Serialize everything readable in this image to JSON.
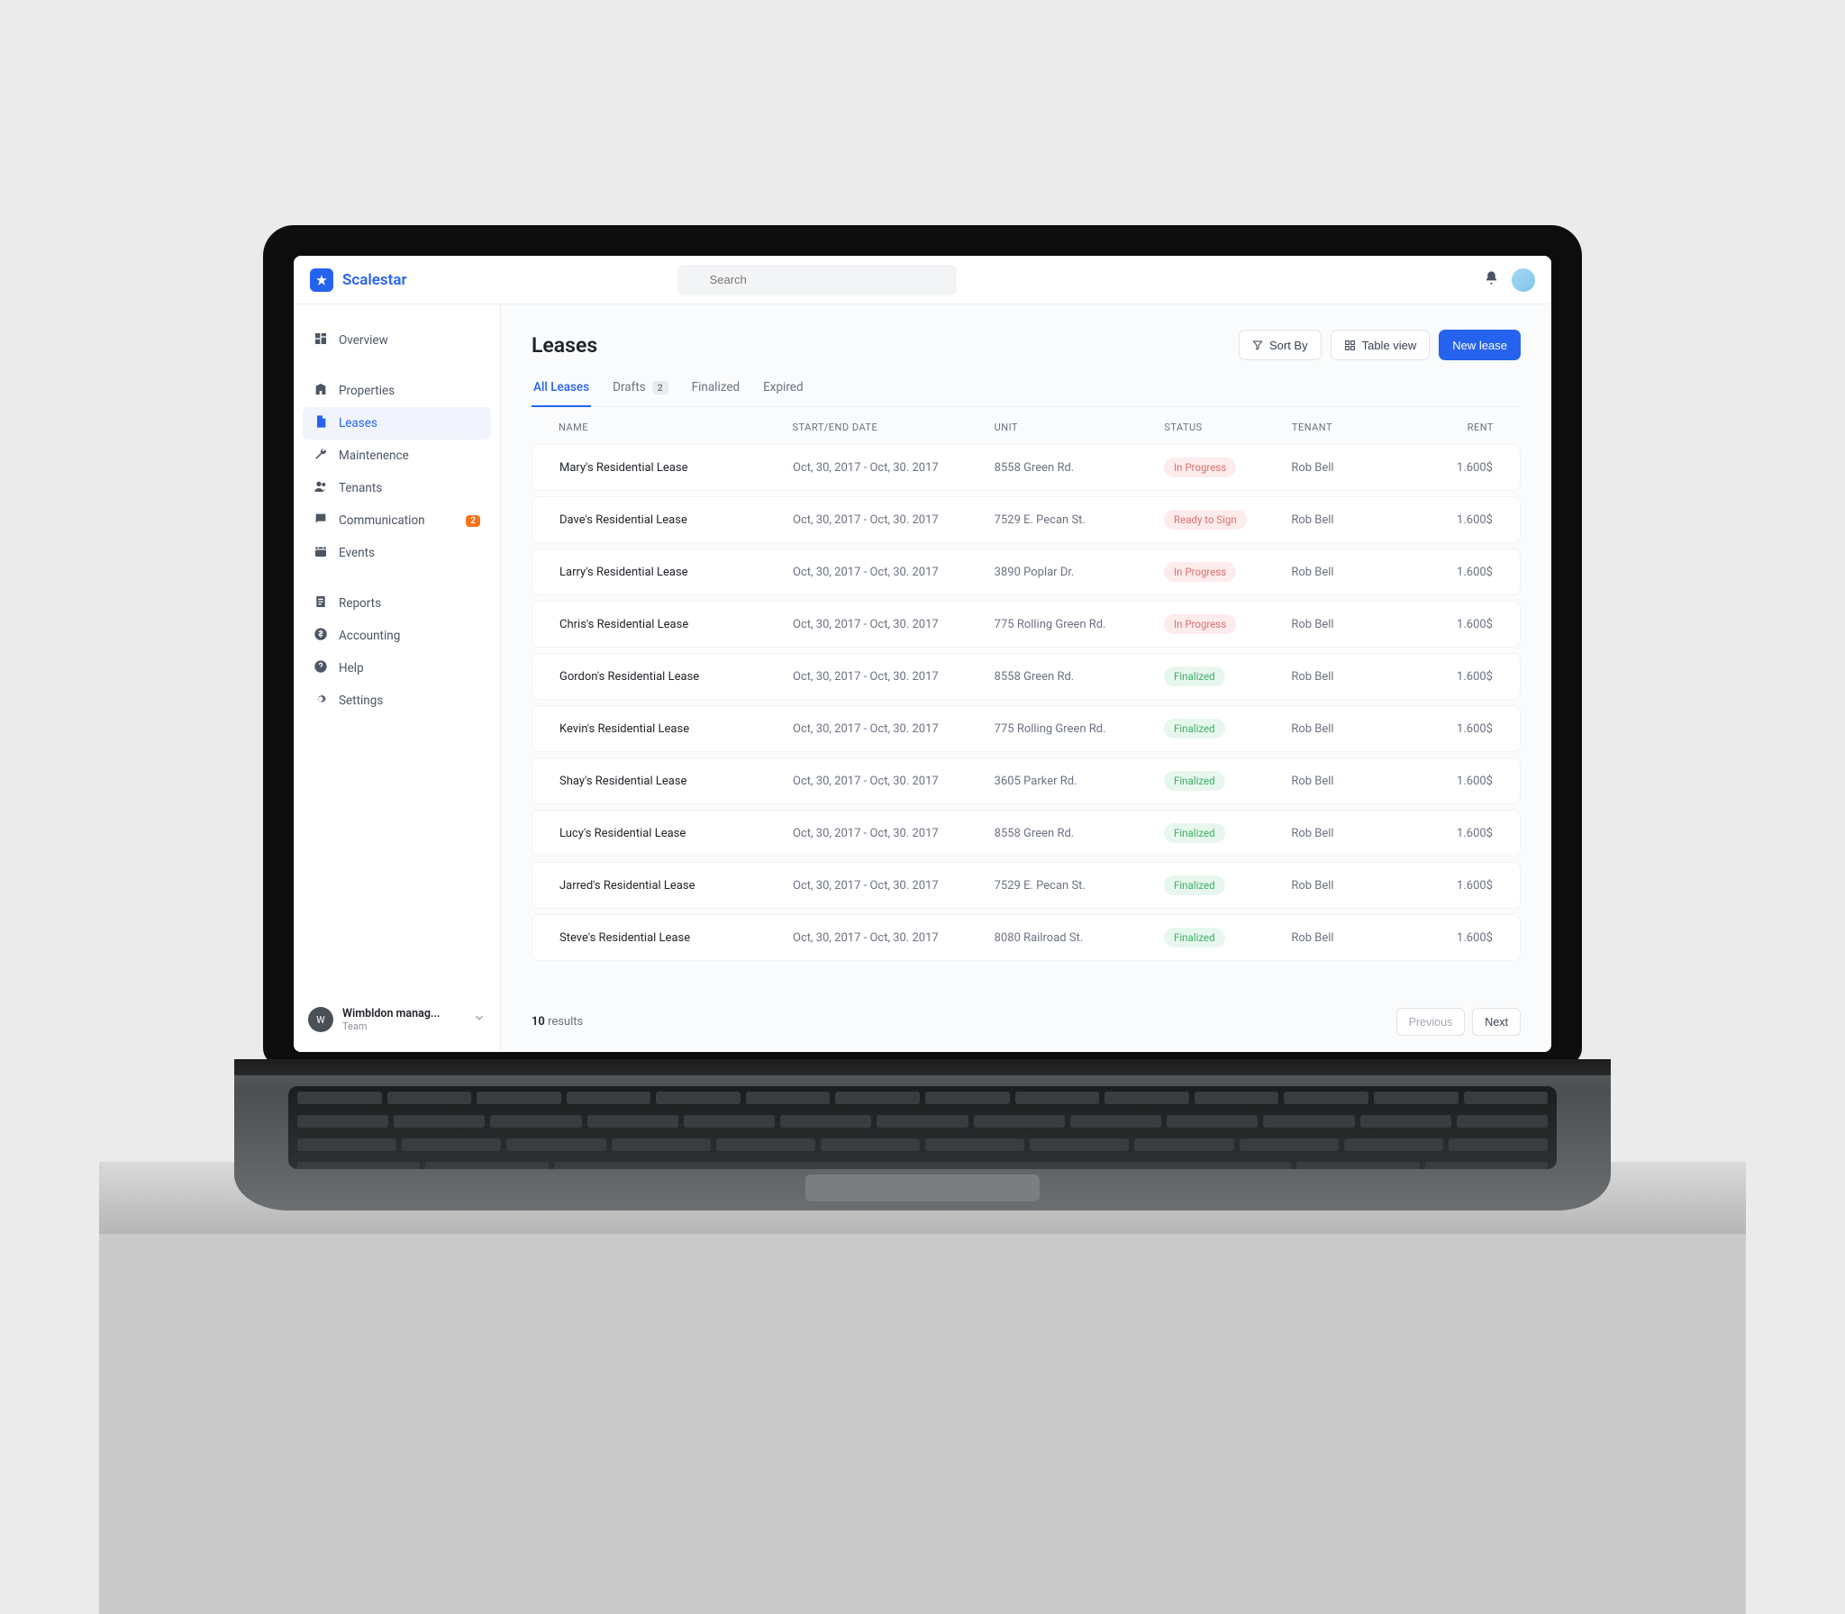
{
  "brand": {
    "name": "Scalestar"
  },
  "search": {
    "placeholder": "Search"
  },
  "sidebar": {
    "nav1": [
      {
        "label": "Overview",
        "icon": "dashboard"
      }
    ],
    "nav2": [
      {
        "label": "Properties",
        "icon": "building"
      },
      {
        "label": "Leases",
        "icon": "file",
        "active": true
      },
      {
        "label": "Maintenence",
        "icon": "wrench"
      },
      {
        "label": "Tenants",
        "icon": "users"
      },
      {
        "label": "Communication",
        "icon": "chat",
        "badge": "2"
      },
      {
        "label": "Events",
        "icon": "calendar"
      }
    ],
    "nav3": [
      {
        "label": "Reports",
        "icon": "report"
      },
      {
        "label": "Accounting",
        "icon": "dollar"
      },
      {
        "label": "Help",
        "icon": "help"
      },
      {
        "label": "Settings",
        "icon": "gear"
      }
    ],
    "team": {
      "name": "Wimbldon manag...",
      "sub": "Team",
      "initials": "W"
    }
  },
  "page": {
    "title": "Leases",
    "actions": {
      "sort": "Sort By",
      "view": "Table view",
      "new": "New lease"
    },
    "tabs": [
      {
        "label": "All Leases",
        "active": true
      },
      {
        "label": "Drafts",
        "badge": "2"
      },
      {
        "label": "Finalized"
      },
      {
        "label": "Expired"
      }
    ],
    "columns": {
      "name": "NAME",
      "date": "START/END DATE",
      "unit": "UNIT",
      "status": "STATUS",
      "tenant": "TENANT",
      "rent": "RENT"
    },
    "rows": [
      {
        "name": "Mary's Residential Lease",
        "date": "Oct, 30, 2017 - Oct, 30. 2017",
        "unit": "8558 Green Rd.",
        "status": "In Progress",
        "statusClass": "inprogress",
        "tenant": "Rob Bell",
        "rent": "1.600$"
      },
      {
        "name": "Dave's Residential Lease",
        "date": "Oct, 30, 2017 - Oct, 30. 2017",
        "unit": "7529 E. Pecan St.",
        "status": "Ready to Sign",
        "statusClass": "ready",
        "tenant": "Rob Bell",
        "rent": "1.600$"
      },
      {
        "name": "Larry's Residential Lease",
        "date": "Oct, 30, 2017 - Oct, 30. 2017",
        "unit": "3890 Poplar Dr.",
        "status": "In Progress",
        "statusClass": "inprogress",
        "tenant": "Rob Bell",
        "rent": "1.600$"
      },
      {
        "name": "Chris's Residential Lease",
        "date": "Oct, 30, 2017 - Oct, 30. 2017",
        "unit": "775 Rolling Green Rd.",
        "status": "In Progress",
        "statusClass": "inprogress",
        "tenant": "Rob Bell",
        "rent": "1.600$"
      },
      {
        "name": "Gordon's Residential Lease",
        "date": "Oct, 30, 2017 - Oct, 30. 2017",
        "unit": "8558 Green Rd.",
        "status": "Finalized",
        "statusClass": "finalized",
        "tenant": "Rob Bell",
        "rent": "1.600$"
      },
      {
        "name": "Kevin's Residential Lease",
        "date": "Oct, 30, 2017 - Oct, 30. 2017",
        "unit": "775 Rolling Green Rd.",
        "status": "Finalized",
        "statusClass": "finalized",
        "tenant": "Rob Bell",
        "rent": "1.600$"
      },
      {
        "name": "Shay's Residential Lease",
        "date": "Oct, 30, 2017 - Oct, 30. 2017",
        "unit": "3605 Parker Rd.",
        "status": "Finalized",
        "statusClass": "finalized",
        "tenant": "Rob Bell",
        "rent": "1.600$"
      },
      {
        "name": "Lucy's Residential Lease",
        "date": "Oct, 30, 2017 - Oct, 30. 2017",
        "unit": "8558 Green Rd.",
        "status": "Finalized",
        "statusClass": "finalized",
        "tenant": "Rob Bell",
        "rent": "1.600$"
      },
      {
        "name": "Jarred's Residential Lease",
        "date": "Oct, 30, 2017 - Oct, 30. 2017",
        "unit": "7529 E. Pecan St.",
        "status": "Finalized",
        "statusClass": "finalized",
        "tenant": "Rob Bell",
        "rent": "1.600$"
      },
      {
        "name": "Steve's Residential Lease",
        "date": "Oct, 30, 2017 - Oct, 30. 2017",
        "unit": "8080 Railroad St.",
        "status": "Finalized",
        "statusClass": "finalized",
        "tenant": "Rob Bell",
        "rent": "1.600$"
      }
    ],
    "footer": {
      "count": "10",
      "label": "results",
      "prev": "Previous",
      "next": "Next"
    }
  }
}
